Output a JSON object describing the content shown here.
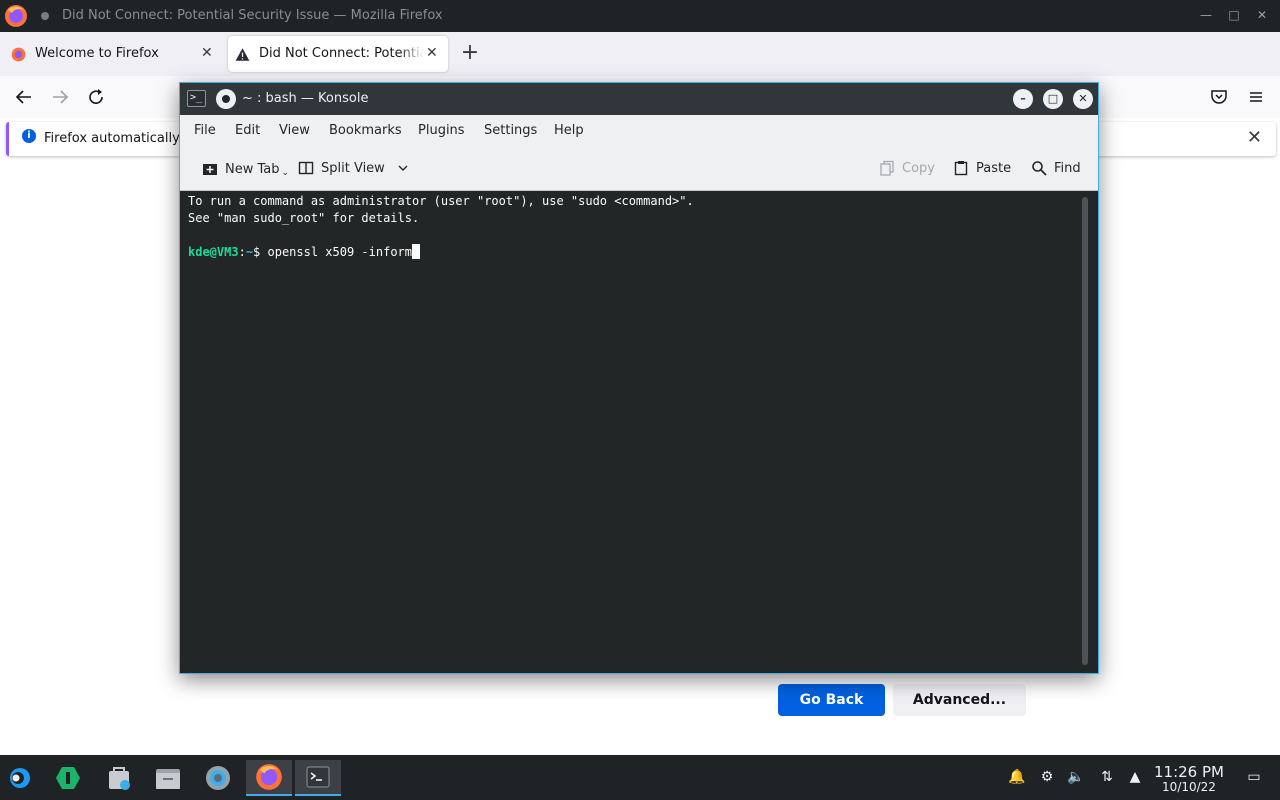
{
  "firefox": {
    "window_title": "Did Not Connect: Potential Security Issue — Mozilla Firefox",
    "tabs": [
      {
        "label": "Welcome to Firefox",
        "icon": "firefox-icon",
        "active": false
      },
      {
        "label": "Did Not Connect: Potential Security Issue",
        "icon": "warning-icon",
        "active": true
      }
    ],
    "infobar_text": "Firefox automatically s",
    "go_back_label": "Go Back",
    "advanced_label": "Advanced..."
  },
  "konsole": {
    "title": "~ : bash — Konsole",
    "menu": [
      "File",
      "Edit",
      "View",
      "Bookmarks",
      "Plugins",
      "Settings",
      "Help"
    ],
    "toolbar": {
      "new_tab": "New Tab",
      "split_view": "Split View",
      "copy": "Copy",
      "paste": "Paste",
      "find": "Find"
    },
    "terminal": {
      "line1": "To run a command as administrator (user \"root\"), use \"sudo <command>\".",
      "line2": "See \"man sudo_root\" for details.",
      "prompt_user": "kde@VM3",
      "prompt_sep": ":",
      "prompt_path": "~",
      "prompt_symbol": "$ ",
      "command": "openssl x509 -inform"
    }
  },
  "taskbar": {
    "apps": [
      "application-launcher-icon",
      "discover-icon",
      "store-icon",
      "file-manager-icon",
      "system-settings-icon",
      "firefox-icon",
      "konsole-icon"
    ],
    "tray": [
      "notifications-icon",
      "updates-icon",
      "volume-icon",
      "network-icon",
      "tray-expand-icon"
    ],
    "clock_time": "11:26 PM",
    "clock_date": "10/10/22"
  },
  "colors": {
    "accent": "#3daee9",
    "firefox_button": "#0061e0",
    "prompt_user": "#1cdc9a"
  }
}
